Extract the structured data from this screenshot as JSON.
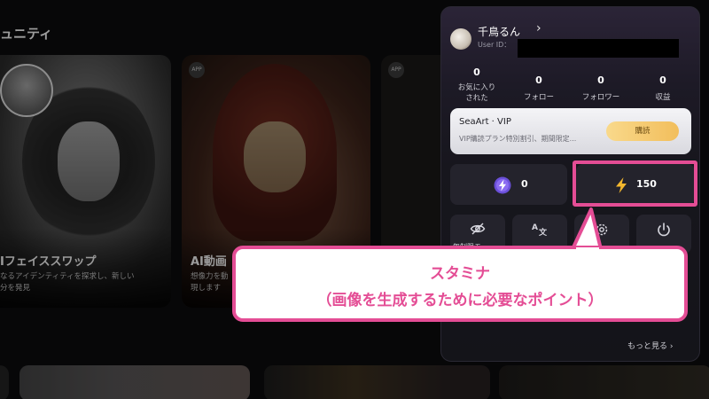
{
  "background": {
    "section_title": "ュニティ",
    "cards": [
      {
        "title": "Iフェイススワップ",
        "desc_line1": "なるアイデンティティを探求し、新しい",
        "desc_line2": "分を発見"
      },
      {
        "badge": "APP",
        "title": "AI動画",
        "desc_line1": "想像力を動",
        "desc_line2": "現します"
      },
      {
        "badge": "APP"
      }
    ]
  },
  "panel": {
    "user_name": "千鳥るん",
    "user_id_label": "User ID：",
    "stats": [
      {
        "value": "0",
        "label_line1": "お気に入り",
        "label_line2": "された"
      },
      {
        "value": "0",
        "label": "フォロー"
      },
      {
        "value": "0",
        "label": "フォロワー"
      },
      {
        "value": "0",
        "label": "収益"
      }
    ],
    "vip": {
      "title": "SeaArt · VIP",
      "desc": "VIP購読プラン特別割引、期間限定...",
      "button": "購読"
    },
    "coins": {
      "purple_value": "0",
      "stamina_value": "150"
    },
    "tools": [
      {
        "icon": "eye-off-icon",
        "label": "無制限モー"
      },
      {
        "icon": "translate-icon",
        "label": ""
      },
      {
        "icon": "gear-icon",
        "label": ""
      },
      {
        "icon": "power-icon",
        "label": ""
      }
    ],
    "more_link": "もっと見る ›"
  },
  "callout": {
    "line1": "スタミナ",
    "line2": "（画像を生成するために必要なポイント）",
    "color": "#e44d95"
  }
}
